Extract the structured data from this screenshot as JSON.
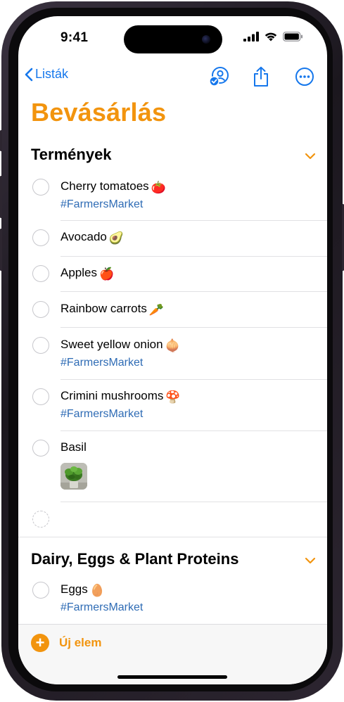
{
  "status_bar": {
    "time": "9:41"
  },
  "nav": {
    "back_label": "Listák",
    "icons": [
      "shared-person-icon",
      "share-icon",
      "more-icon"
    ]
  },
  "list_title": "Bevásárlás",
  "accent_color": "#f2940e",
  "sections": [
    {
      "name": "Termények",
      "items": [
        {
          "title": "Cherry tomatoes",
          "emoji": "🍅",
          "tag": "#FarmersMarket"
        },
        {
          "title": "Avocado",
          "emoji": "🥑",
          "tag": ""
        },
        {
          "title": "Apples",
          "emoji": "🍎",
          "tag": ""
        },
        {
          "title": "Rainbow carrots",
          "emoji": "🥕",
          "tag": ""
        },
        {
          "title": "Sweet yellow onion",
          "emoji": "🧅",
          "tag": "#FarmersMarket"
        },
        {
          "title": "Crimini mushrooms",
          "emoji": "🍄",
          "tag": "#FarmersMarket"
        },
        {
          "title": "Basil",
          "emoji": "",
          "tag": "",
          "image": "basil-plant-photo"
        }
      ]
    },
    {
      "name": "Dairy, Eggs & Plant Proteins",
      "items": [
        {
          "title": "Eggs",
          "emoji": "🥚",
          "tag": "#FarmersMarket"
        }
      ]
    }
  ],
  "bottom_bar": {
    "new_item_label": "Új elem"
  }
}
